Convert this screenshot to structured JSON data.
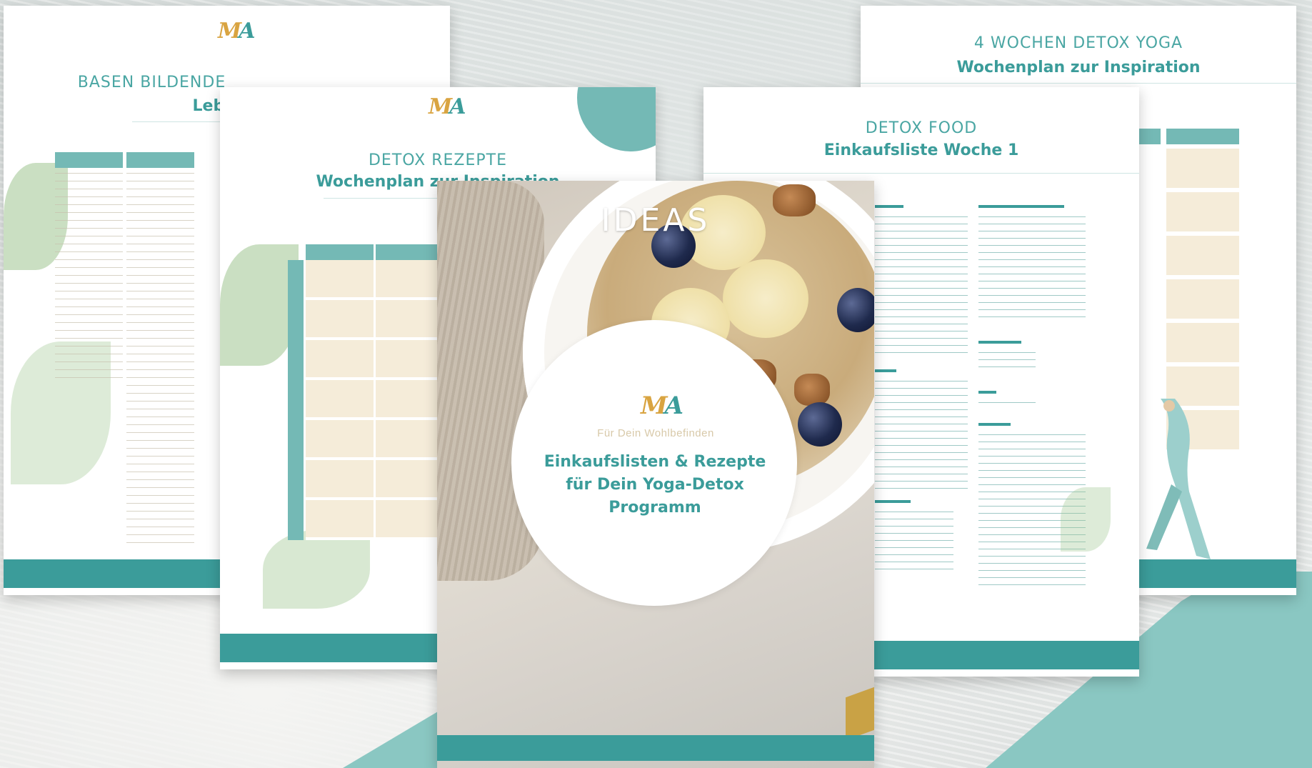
{
  "pages": {
    "basen": {
      "title_light": "BASEN BILDENDE",
      "title_bold": "Leber"
    },
    "rezepte": {
      "title_light": "DETOX REZEPTE",
      "title_bold": "Wochenplan zur Inspiration"
    },
    "yoga": {
      "title_light": "4 WOCHEN DETOX YOGA",
      "title_bold": "Wochenplan zur Inspiration"
    },
    "food": {
      "title_light": "DETOX FOOD",
      "title_bold": "Einkaufsliste Woche 1"
    }
  },
  "cover": {
    "overlay_label": "IDEAS",
    "subtitle": "Für Dein Wohlbefinden",
    "title_line1": "Einkaufslisten & Rezepte",
    "title_line2": "für Dein Yoga-Detox",
    "title_line3": "Programm"
  },
  "colors": {
    "teal": "#3b9c9a",
    "teal_light": "#8ac7c2",
    "beige": "#f5ecd9",
    "gold": "#d9a441"
  },
  "icons": [
    "logo-mark"
  ]
}
